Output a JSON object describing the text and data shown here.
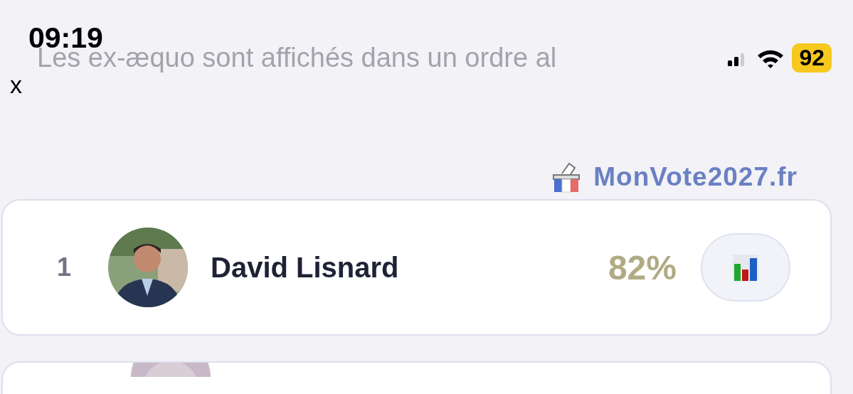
{
  "status_bar": {
    "time": "09:19",
    "battery": "92"
  },
  "notice": "Les ex-æquo sont affichés dans un ordre al",
  "close": "x",
  "brand": "MonVote2027.fr",
  "candidates": [
    {
      "rank": "1",
      "name": "David Lisnard",
      "percent": "82%"
    }
  ]
}
